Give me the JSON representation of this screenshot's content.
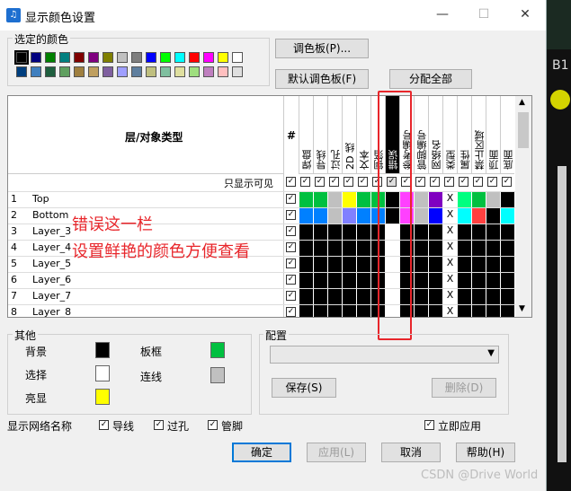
{
  "window": {
    "title": "显示颜色设置",
    "minimize": "—",
    "maximize": "☐",
    "close": "✕"
  },
  "selected_colors": {
    "label": "选定的颜色",
    "row1": [
      "#000000",
      "#00007f",
      "#007f00",
      "#007f7f",
      "#7f0000",
      "#7f007f",
      "#7f7f00",
      "#c0c0c0",
      "#7f7f7f",
      "#0000ff",
      "#00ff00",
      "#00ffff",
      "#ff0000",
      "#ff00ff",
      "#ffff00",
      "#ffffff"
    ],
    "row2": [
      "#003f7f",
      "#3f7fbf",
      "#1f5f3f",
      "#5f9f5f",
      "#9f7f3f",
      "#bf9f5f",
      "#7f5f9f",
      "#9f9fff",
      "#5f7f9f",
      "#bfbf7f",
      "#7fbf9f",
      "#dfdf9f",
      "#9fdf7f",
      "#bf7fbf",
      "#ffbfbf",
      "#dfdfdf"
    ]
  },
  "buttons": {
    "palette": "调色板(P)...",
    "default_palette": "默认调色板(F)",
    "assign_all": "分配全部",
    "save": "保存(S)",
    "delete": "删除(D)",
    "ok": "确定",
    "apply": "应用(L)",
    "cancel": "取消",
    "help": "帮助(H)"
  },
  "table": {
    "layer_header": "层/对象类型",
    "hash_header": "#",
    "columns": [
      "焊盘",
      "导线",
      "过孔",
      "2D 线",
      "文本",
      "铜箔",
      "错误",
      "参考编号",
      "管脚编号",
      "网络名",
      "类型",
      "属性",
      "禁止区域",
      "顶面",
      "底面"
    ],
    "visible_only": "只显示可见",
    "rows": [
      {
        "n": "1",
        "name": "Top"
      },
      {
        "n": "2",
        "name": "Bottom"
      },
      {
        "n": "3",
        "name": "Layer_3"
      },
      {
        "n": "4",
        "name": "Layer_4"
      },
      {
        "n": "5",
        "name": "Layer_5"
      },
      {
        "n": "6",
        "name": "Layer_6"
      },
      {
        "n": "7",
        "name": "Layer_7"
      },
      {
        "n": "8",
        "name": "Layer_8"
      }
    ],
    "row_colors": [
      [
        "#00c040",
        "#00c040",
        "#c0c0c0",
        "#ffff00",
        "#00c040",
        "#00c040",
        "#000000",
        "#ff40ff",
        "#c0c0c0",
        "#8000c0",
        "X",
        "#00ff80",
        "#00c040",
        "#c0c0c0",
        "#000000"
      ],
      [
        "#0080ff",
        "#0080ff",
        "#c0c0c0",
        "#8080ff",
        "#0080ff",
        "#0080ff",
        "#000000",
        "#ff40ff",
        "#c0c0c0",
        "#0000ff",
        "X",
        "#00ffff",
        "#ff4040",
        "#000000",
        "#00ffff"
      ],
      [
        "#000000",
        "#000000",
        "#000000",
        "#000000",
        "#000000",
        "#000000",
        "#ffffff",
        "#000000",
        "#000000",
        "#000000",
        "X",
        "#000000",
        "#000000",
        "#000000",
        "#000000"
      ],
      [
        "#000000",
        "#000000",
        "#000000",
        "#000000",
        "#000000",
        "#000000",
        "#ffffff",
        "#000000",
        "#000000",
        "#000000",
        "X",
        "#000000",
        "#000000",
        "#000000",
        "#000000"
      ],
      [
        "#000000",
        "#000000",
        "#000000",
        "#000000",
        "#000000",
        "#000000",
        "#ffffff",
        "#000000",
        "#000000",
        "#000000",
        "X",
        "#000000",
        "#000000",
        "#000000",
        "#000000"
      ],
      [
        "#000000",
        "#000000",
        "#000000",
        "#000000",
        "#000000",
        "#000000",
        "#ffffff",
        "#000000",
        "#000000",
        "#000000",
        "X",
        "#000000",
        "#000000",
        "#000000",
        "#000000"
      ],
      [
        "#000000",
        "#000000",
        "#000000",
        "#000000",
        "#000000",
        "#000000",
        "#ffffff",
        "#000000",
        "#000000",
        "#000000",
        "X",
        "#000000",
        "#000000",
        "#000000",
        "#000000"
      ],
      [
        "#000000",
        "#000000",
        "#000000",
        "#000000",
        "#000000",
        "#000000",
        "#ffffff",
        "#000000",
        "#000000",
        "#000000",
        "X",
        "#000000",
        "#000000",
        "#000000",
        "#000000"
      ]
    ]
  },
  "annotation": {
    "line1": "错误这一栏",
    "line2": "设置鲜艳的颜色方便查看",
    "color": "#e8262b"
  },
  "other": {
    "label": "其他",
    "background": "背景",
    "background_color": "#000000",
    "frame": "板框",
    "frame_color": "#00c040",
    "selection": "选择",
    "selection_color": "#ffffff",
    "connection": "连线",
    "connection_color": "#c0c0c0",
    "highlight": "亮显",
    "highlight_color": "#ffff00"
  },
  "config": {
    "label": "配置",
    "value": ""
  },
  "bottom": {
    "show_net_name": "显示网络名称",
    "trace": "导线",
    "via": "过孔",
    "pin": "管脚",
    "apply_now": "立即应用"
  },
  "background_pcb": {
    "label": "B1",
    "watermark": "CSDN @Drive World"
  }
}
